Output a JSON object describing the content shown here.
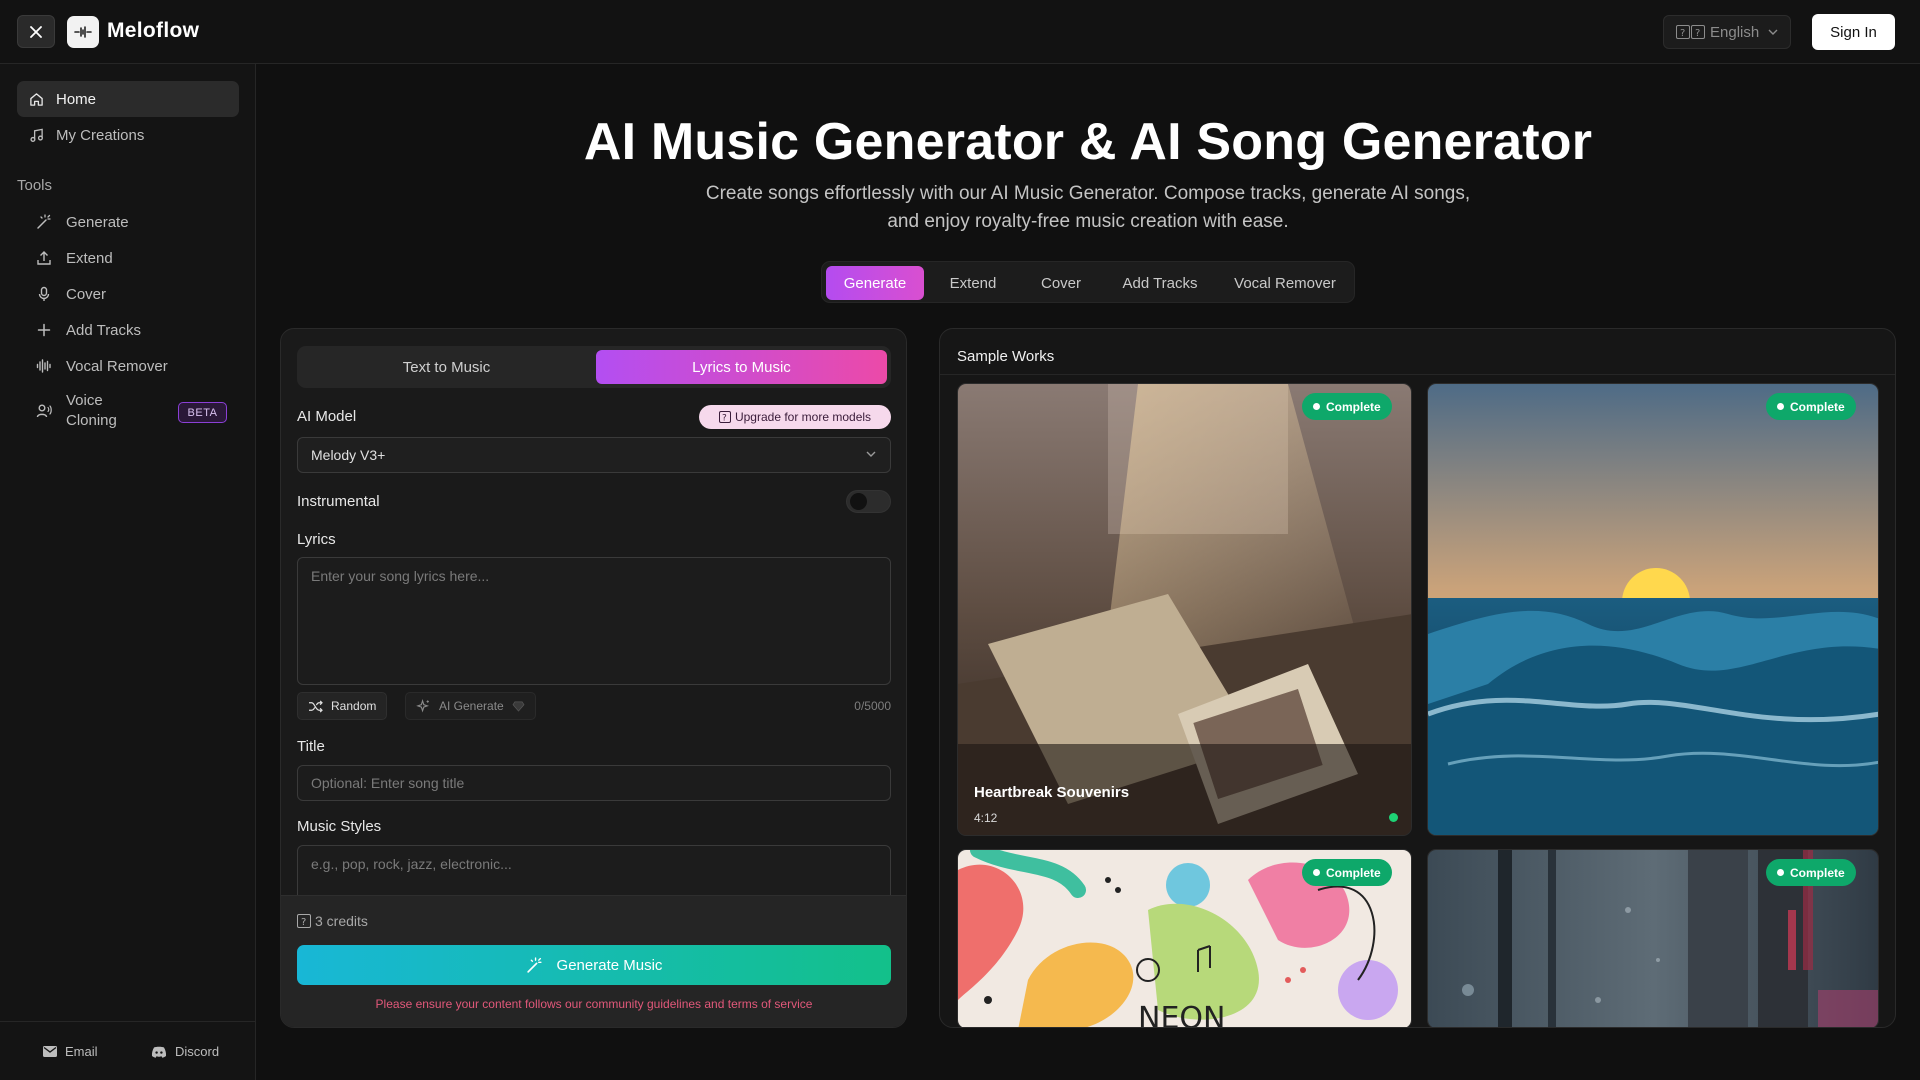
{
  "header": {
    "brand": "Meloflow",
    "language": "English",
    "sign_in": "Sign In"
  },
  "sidebar": {
    "nav": [
      {
        "label": "Home",
        "icon": "home-icon",
        "active": true
      },
      {
        "label": "My Creations",
        "icon": "music-note-icon",
        "active": false
      }
    ],
    "tools_label": "Tools",
    "tools": [
      {
        "label": "Generate",
        "icon": "magic-wand-icon"
      },
      {
        "label": "Extend",
        "icon": "upload-icon"
      },
      {
        "label": "Cover",
        "icon": "microphone-icon"
      },
      {
        "label": "Add Tracks",
        "icon": "plus-icon"
      },
      {
        "label": "Vocal Remover",
        "icon": "waveform-icon"
      }
    ],
    "voice_cloning": {
      "line1": "Voice",
      "line2": "Cloning",
      "badge": "BETA"
    },
    "footer": {
      "email": "Email",
      "discord": "Discord"
    }
  },
  "hero": {
    "title": "AI Music Generator & AI Song Generator",
    "subtitle": "Create songs effortlessly with our AI Music Generator. Compose tracks, generate AI songs, and enjoy royalty-free music creation with ease."
  },
  "main_tabs": [
    {
      "label": "Generate",
      "active": true
    },
    {
      "label": "Extend",
      "active": false
    },
    {
      "label": "Cover",
      "active": false
    },
    {
      "label": "Add Tracks",
      "active": false
    },
    {
      "label": "Vocal Remover",
      "active": false
    }
  ],
  "form": {
    "modes": [
      {
        "label": "Text to Music",
        "active": false
      },
      {
        "label": "Lyrics to Music",
        "active": true
      }
    ],
    "model_label": "AI Model",
    "upgrade_label": "Upgrade for more models",
    "model_value": "Melody V3+",
    "instrumental_label": "Instrumental",
    "instrumental_on": false,
    "lyrics_label": "Lyrics",
    "lyrics_placeholder": "Enter your song lyrics here...",
    "random_label": "Random",
    "ai_generate_label": "AI Generate",
    "char_count": "0/5000",
    "title_label": "Title",
    "title_placeholder": "Optional: Enter song title",
    "styles_label": "Music Styles",
    "styles_placeholder": "e.g., pop, rock, jazz, electronic...",
    "credits": "3 credits",
    "generate_button": "Generate Music",
    "notice": "Please ensure your content follows our community guidelines and terms of service"
  },
  "samples": {
    "title": "Sample Works",
    "cards": [
      {
        "status": "Complete",
        "title": "Heartbreak Souvenirs",
        "duration": "4:12"
      },
      {
        "status": "Complete"
      },
      {
        "status": "Complete",
        "art_text": "NEON"
      },
      {
        "status": "Complete"
      }
    ]
  },
  "colors": {
    "accent_purple": "#b44cf0",
    "accent_pink": "#ec4aa8",
    "generate_gradient_start": "#18b7d6",
    "generate_gradient_end": "#13c08a",
    "complete_green": "#0ea86a",
    "notice_red": "#e2587a"
  }
}
